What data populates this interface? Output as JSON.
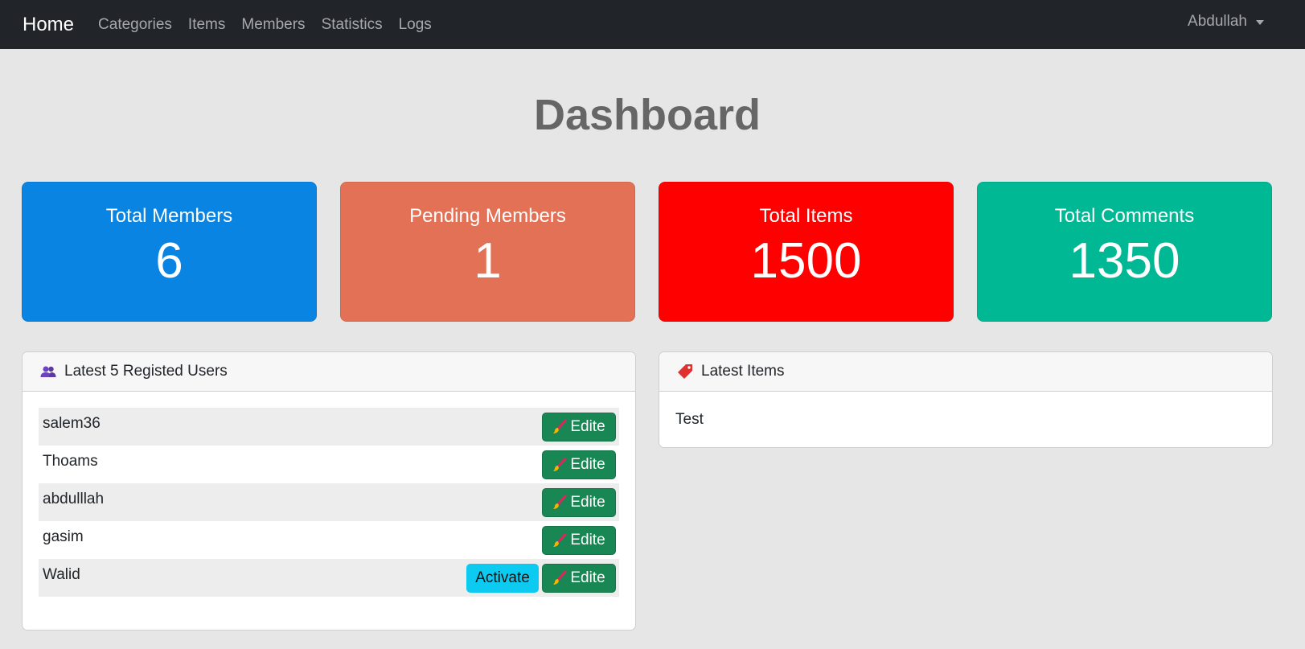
{
  "navbar": {
    "brand": "Home",
    "links": [
      "Categories",
      "Items",
      "Members",
      "Statistics",
      "Logs"
    ],
    "user": "Abdullah"
  },
  "page_title": "Dashboard",
  "stats": [
    {
      "label": "Total Members",
      "value": "6",
      "color": "#0a84e3"
    },
    {
      "label": "Pending Members",
      "value": "1",
      "color": "#e27156"
    },
    {
      "label": "Total Items",
      "value": "1500",
      "color": "#ff0000"
    },
    {
      "label": "Total Comments",
      "value": "1350",
      "color": "#00b894"
    }
  ],
  "users_panel": {
    "icon": "users-icon",
    "title": "Latest 5 Registed Users",
    "edit_label": "Edite",
    "activate_label": "Activate",
    "users": [
      "salem36",
      "Thoams",
      "abdulllah",
      "gasim",
      "Walid"
    ]
  },
  "items_panel": {
    "icon": "tag-icon",
    "title": "Latest Items",
    "items": [
      "Test"
    ]
  }
}
